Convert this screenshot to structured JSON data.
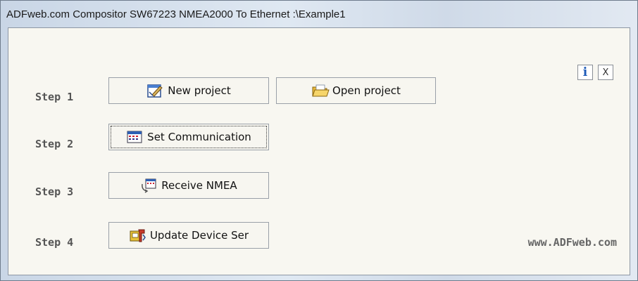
{
  "window": {
    "title": "ADFweb.com Compositor SW67223 NMEA2000 To Ethernet :\\Example1"
  },
  "steps": [
    {
      "label": "Step 1"
    },
    {
      "label": "Step 2"
    },
    {
      "label": "Step 3"
    },
    {
      "label": "Step 4"
    }
  ],
  "buttons": {
    "new_project": "New project",
    "open_project": "Open project",
    "set_communication": "Set Communication",
    "receive_nmea": "Receive NMEA",
    "update_device": "Update Device Ser"
  },
  "top_icons": {
    "info": "i",
    "close": "X"
  },
  "website": "www.ADFweb.com",
  "icons": {
    "new_project": "new-project-icon",
    "open_project": "folder-open-icon",
    "set_communication": "settings-window-icon",
    "receive_nmea": "receive-icon",
    "update_device": "update-device-icon"
  }
}
